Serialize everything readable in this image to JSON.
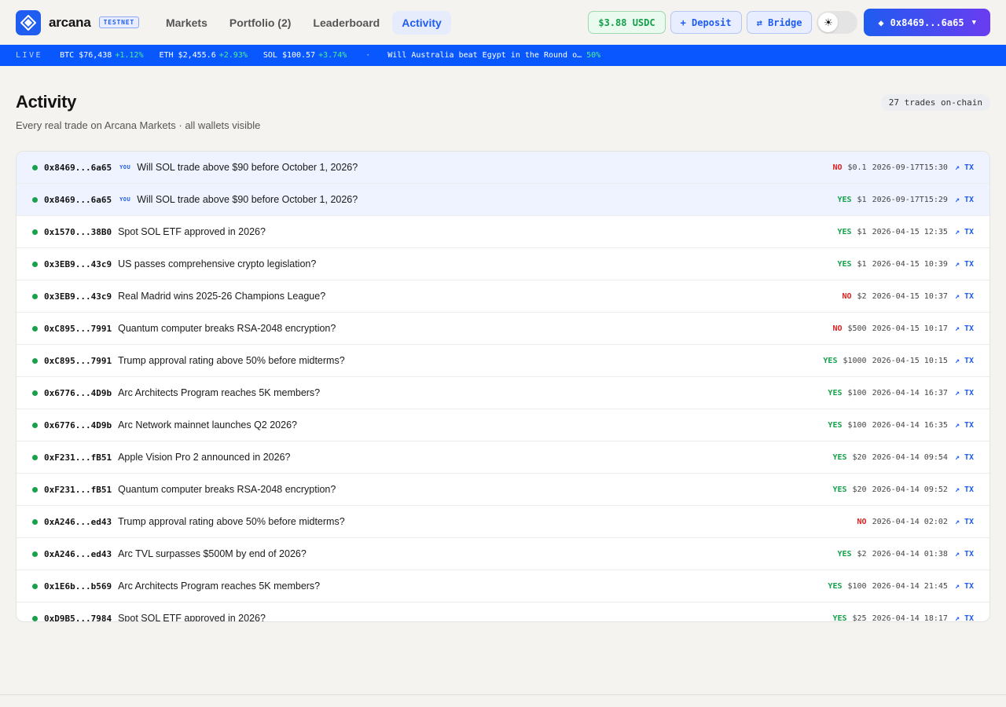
{
  "header": {
    "logo_text": "arcana",
    "network_badge": "TESTNET",
    "nav": [
      {
        "label": "Markets"
      },
      {
        "label": "Portfolio (2)"
      },
      {
        "label": "Leaderboard"
      },
      {
        "label": "Activity",
        "active": true
      }
    ],
    "balance": "$3.88 USDC",
    "deposit_label": "+ Deposit",
    "bridge_label": "⇄ Bridge",
    "theme_icon": "sun-icon",
    "wallet_label": "0x8469...6a65",
    "wallet_icon": "diamond-icon"
  },
  "ticker": {
    "live_label": "LIVE",
    "items": [
      {
        "symbol": "BTC",
        "price": "$76,438",
        "change": "+1.12%"
      },
      {
        "symbol": "ETH",
        "price": "$2,455.6",
        "change": "+2.93%"
      },
      {
        "symbol": "SOL",
        "price": "$100.57",
        "change": "+3.74%"
      }
    ],
    "separator": "·",
    "headline": "Will Australia beat Egypt in the Round o…",
    "headline_prob": "50%"
  },
  "page": {
    "title": "Activity",
    "subtitle": "Every real trade on Arcana Markets · all wallets visible",
    "count_label": "27 trades on-chain"
  },
  "you_label": "YOU",
  "tx_label": "↗ TX",
  "trades": [
    {
      "wallet": "0x8469...6a65",
      "you": true,
      "market": "Will SOL trade above $90 before October 1, 2026?",
      "side": "NO",
      "amount": "$0.1",
      "time": "2026-09-17T15:30"
    },
    {
      "wallet": "0x8469...6a65",
      "you": true,
      "market": "Will SOL trade above $90 before October 1, 2026?",
      "side": "YES",
      "amount": "$1",
      "time": "2026-09-17T15:29"
    },
    {
      "wallet": "0x1570...38B0",
      "you": false,
      "market": "Spot SOL ETF approved in 2026?",
      "side": "YES",
      "amount": "$1",
      "time": "2026-04-15 12:35"
    },
    {
      "wallet": "0x3EB9...43c9",
      "you": false,
      "market": "US passes comprehensive crypto legislation?",
      "side": "YES",
      "amount": "$1",
      "time": "2026-04-15 10:39"
    },
    {
      "wallet": "0x3EB9...43c9",
      "you": false,
      "market": "Real Madrid wins 2025-26 Champions League?",
      "side": "NO",
      "amount": "$2",
      "time": "2026-04-15 10:37"
    },
    {
      "wallet": "0xC895...7991",
      "you": false,
      "market": "Quantum computer breaks RSA-2048 encryption?",
      "side": "NO",
      "amount": "$500",
      "time": "2026-04-15 10:17"
    },
    {
      "wallet": "0xC895...7991",
      "you": false,
      "market": "Trump approval rating above 50% before midterms?",
      "side": "YES",
      "amount": "$1000",
      "time": "2026-04-15 10:15"
    },
    {
      "wallet": "0x6776...4D9b",
      "you": false,
      "market": "Arc Architects Program reaches 5K members?",
      "side": "YES",
      "amount": "$100",
      "time": "2026-04-14 16:37"
    },
    {
      "wallet": "0x6776...4D9b",
      "you": false,
      "market": "Arc Network mainnet launches Q2 2026?",
      "side": "YES",
      "amount": "$100",
      "time": "2026-04-14 16:35"
    },
    {
      "wallet": "0xF231...fB51",
      "you": false,
      "market": "Apple Vision Pro 2 announced in 2026?",
      "side": "YES",
      "amount": "$20",
      "time": "2026-04-14 09:54"
    },
    {
      "wallet": "0xF231...fB51",
      "you": false,
      "market": "Quantum computer breaks RSA-2048 encryption?",
      "side": "YES",
      "amount": "$20",
      "time": "2026-04-14 09:52"
    },
    {
      "wallet": "0xA246...ed43",
      "you": false,
      "market": "Trump approval rating above 50% before midterms?",
      "side": "NO",
      "amount": "",
      "time": "2026-04-14 02:02"
    },
    {
      "wallet": "0xA246...ed43",
      "you": false,
      "market": "Arc TVL surpasses $500M by end of 2026?",
      "side": "YES",
      "amount": "$2",
      "time": "2026-04-14 01:38"
    },
    {
      "wallet": "0x1E6b...b569",
      "you": false,
      "market": "Arc Architects Program reaches 5K members?",
      "side": "YES",
      "amount": "$100",
      "time": "2026-04-14 21:45"
    },
    {
      "wallet": "0xD9B5...7984",
      "you": false,
      "market": "Spot SOL ETF approved in 2026?",
      "side": "YES",
      "amount": "$25",
      "time": "2026-04-14 18:17"
    }
  ],
  "colors": {
    "brand": "#1f5cf0",
    "ticker_bg": "#0958ff",
    "yes": "#14a04a",
    "no": "#e02020",
    "you_row_bg": "#eef3ff"
  }
}
